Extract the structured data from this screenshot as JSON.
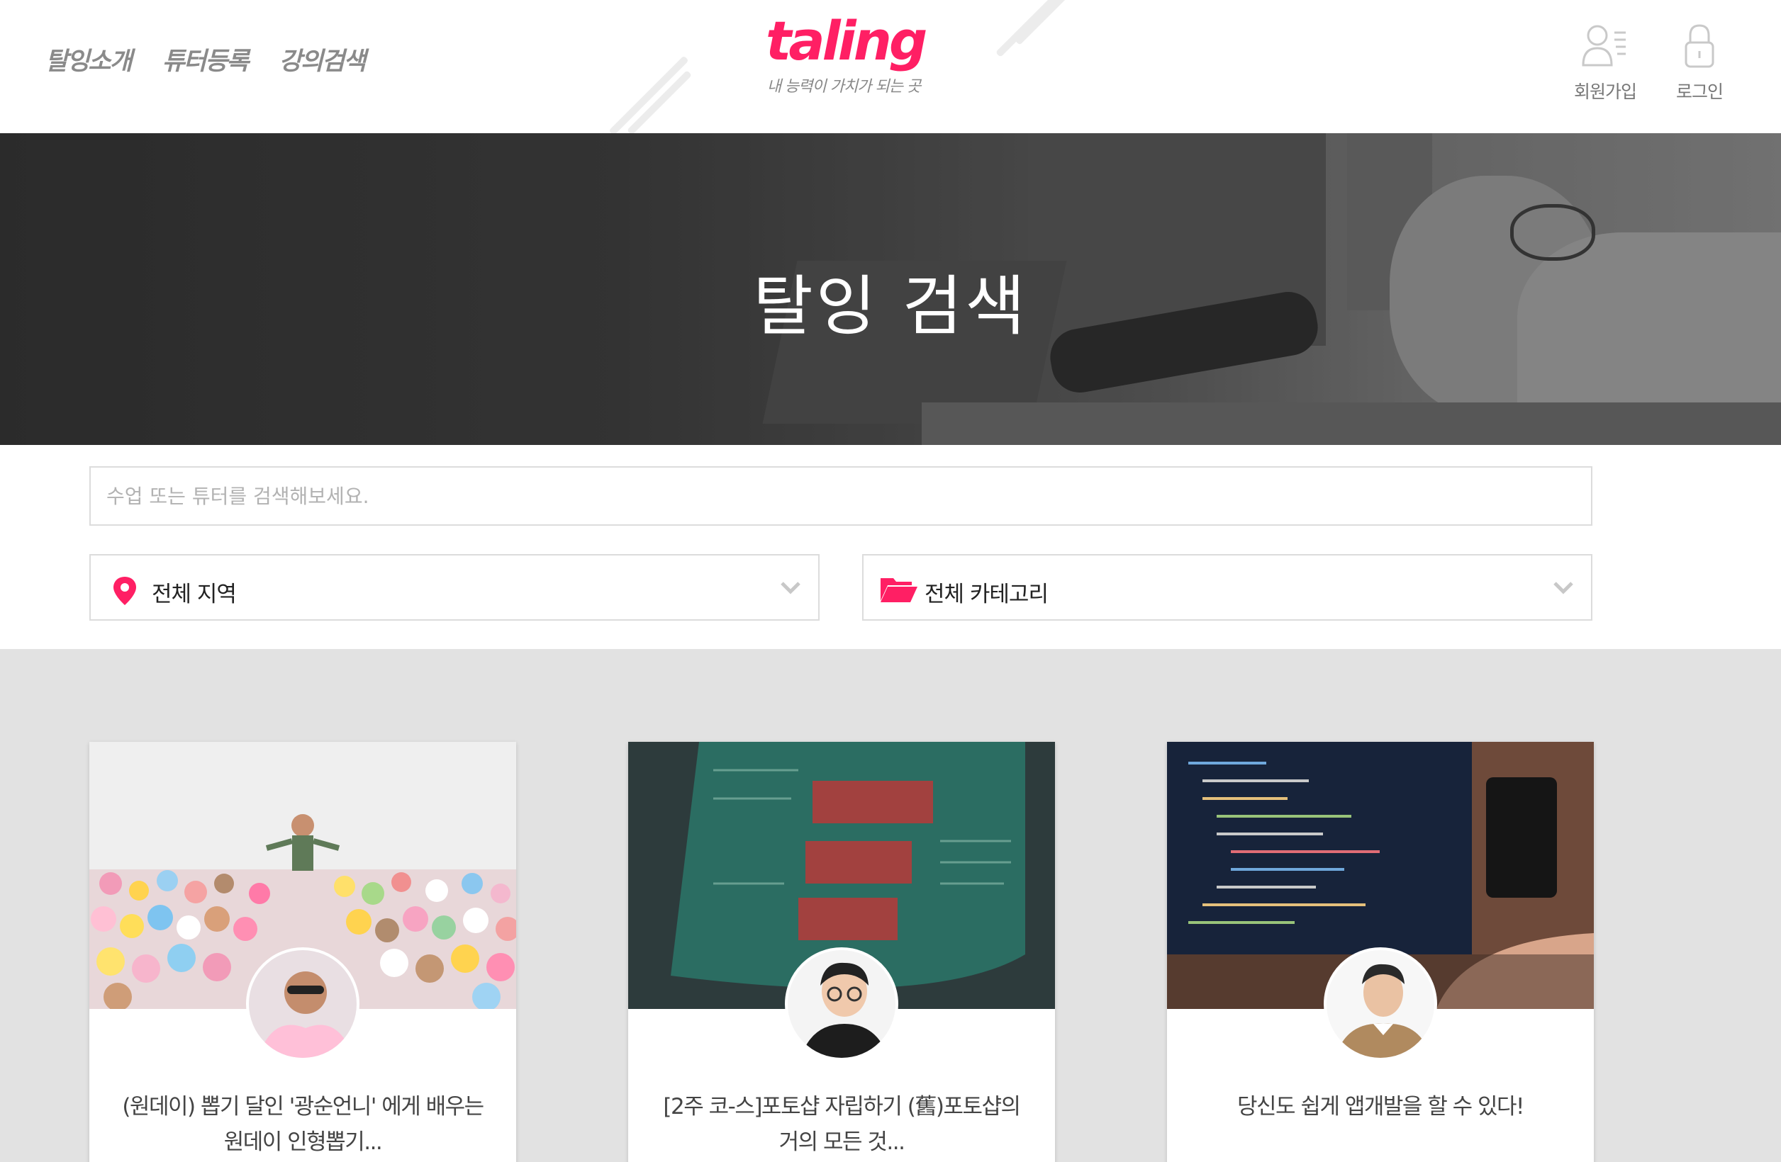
{
  "header": {
    "nav": [
      {
        "label": "탈잉소개"
      },
      {
        "label": "튜터등록"
      },
      {
        "label": "강의검색"
      }
    ],
    "logo": {
      "word": "taling",
      "tagline": "내 능력이 가치가 되는 곳"
    },
    "actions": [
      {
        "label": "회원가입",
        "icon": "user-list-icon"
      },
      {
        "label": "로그인",
        "icon": "lock-icon"
      }
    ]
  },
  "hero": {
    "title": "탈잉 검색"
  },
  "search": {
    "placeholder": "수업 또는 튜터를 검색해보세요.",
    "value": ""
  },
  "filters": {
    "region": {
      "value": "전체 지역",
      "icon": "location-pin-icon"
    },
    "category": {
      "value": "전체 카테고리",
      "icon": "folder-open-icon"
    }
  },
  "colors": {
    "brand": "#ff1f64",
    "content_bg": "#e2e2e2"
  },
  "cards": [
    {
      "title_line1": "(원데이) 뽑기 달인 '광순언니' 에게 배우는",
      "title_line2": "원데이 인형뽑기..."
    },
    {
      "title_line1": "[2주 코-스]포토샵 자립하기 (舊)포토샵의",
      "title_line2": "거의 모든 것..."
    },
    {
      "title_line1": "당신도 쉽게 앱개발을 할 수 있다!",
      "title_line2": ""
    }
  ]
}
